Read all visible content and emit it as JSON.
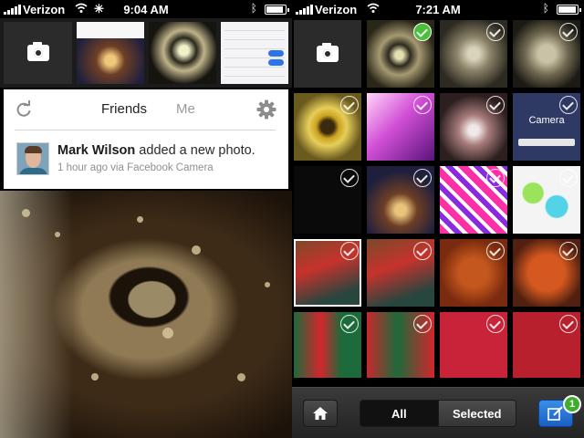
{
  "left_screen": {
    "status": {
      "carrier": "Verizon",
      "time": "9:04 AM",
      "battery_fraction": 0.8
    },
    "tabs": {
      "friends": "Friends",
      "me": "Me"
    },
    "feed_item": {
      "name": "Mark Wilson",
      "action": " added a new photo.",
      "meta": "1 hour ago via Facebook Camera"
    }
  },
  "right_screen": {
    "status": {
      "carrier": "Verizon",
      "time": "7:21 AM",
      "battery_fraction": 0.85
    },
    "tile_camera_label": "Camera",
    "bottom": {
      "all_label": "All",
      "selected_label": "Selected",
      "badge_count": "1"
    },
    "selected_count_checked": 1
  },
  "colors": {
    "accent_blue": "#2d74e4",
    "check_green": "#4bbf3c",
    "badge_green": "#3fae2e"
  },
  "icons": [
    "camera-icon",
    "refresh-icon",
    "gear-icon",
    "check-icon",
    "home-icon",
    "compose-icon",
    "wifi-icon",
    "bluetooth-icon",
    "battery-icon"
  ]
}
